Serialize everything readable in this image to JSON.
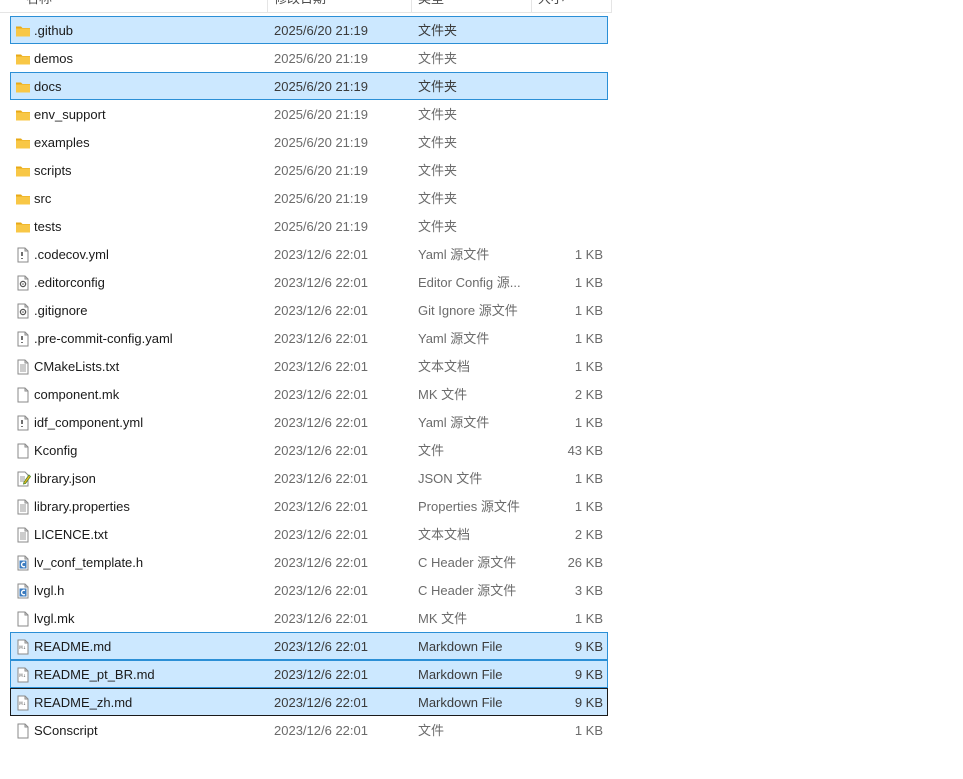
{
  "header": {
    "name": "名称",
    "date": "修改日期",
    "type": "类型",
    "size": "大小"
  },
  "files": [
    {
      "name": ".github",
      "date": "2025/6/20 21:19",
      "type": "文件夹",
      "size": "",
      "icon": "folder-icon",
      "state": "selected"
    },
    {
      "name": "demos",
      "date": "2025/6/20 21:19",
      "type": "文件夹",
      "size": "",
      "icon": "folder-icon",
      "state": ""
    },
    {
      "name": "docs",
      "date": "2025/6/20 21:19",
      "type": "文件夹",
      "size": "",
      "icon": "folder-icon",
      "state": "selected"
    },
    {
      "name": "env_support",
      "date": "2025/6/20 21:19",
      "type": "文件夹",
      "size": "",
      "icon": "folder-icon",
      "state": ""
    },
    {
      "name": "examples",
      "date": "2025/6/20 21:19",
      "type": "文件夹",
      "size": "",
      "icon": "folder-icon",
      "state": ""
    },
    {
      "name": "scripts",
      "date": "2025/6/20 21:19",
      "type": "文件夹",
      "size": "",
      "icon": "folder-icon",
      "state": ""
    },
    {
      "name": "src",
      "date": "2025/6/20 21:19",
      "type": "文件夹",
      "size": "",
      "icon": "folder-icon",
      "state": ""
    },
    {
      "name": "tests",
      "date": "2025/6/20 21:19",
      "type": "文件夹",
      "size": "",
      "icon": "folder-icon",
      "state": ""
    },
    {
      "name": ".codecov.yml",
      "date": "2023/12/6 22:01",
      "type": "Yaml 源文件",
      "size": "1 KB",
      "icon": "yaml-file-icon",
      "state": ""
    },
    {
      "name": ".editorconfig",
      "date": "2023/12/6 22:01",
      "type": "Editor Config 源...",
      "size": "1 KB",
      "icon": "config-file-icon",
      "state": ""
    },
    {
      "name": ".gitignore",
      "date": "2023/12/6 22:01",
      "type": "Git Ignore 源文件",
      "size": "1 KB",
      "icon": "config-file-icon",
      "state": ""
    },
    {
      "name": ".pre-commit-config.yaml",
      "date": "2023/12/6 22:01",
      "type": "Yaml 源文件",
      "size": "1 KB",
      "icon": "yaml-file-icon",
      "state": ""
    },
    {
      "name": "CMakeLists.txt",
      "date": "2023/12/6 22:01",
      "type": "文本文档",
      "size": "1 KB",
      "icon": "text-file-icon",
      "state": ""
    },
    {
      "name": "component.mk",
      "date": "2023/12/6 22:01",
      "type": "MK 文件",
      "size": "2 KB",
      "icon": "blank-file-icon",
      "state": ""
    },
    {
      "name": "idf_component.yml",
      "date": "2023/12/6 22:01",
      "type": "Yaml 源文件",
      "size": "1 KB",
      "icon": "yaml-file-icon",
      "state": ""
    },
    {
      "name": "Kconfig",
      "date": "2023/12/6 22:01",
      "type": "文件",
      "size": "43 KB",
      "icon": "blank-file-icon",
      "state": ""
    },
    {
      "name": "library.json",
      "date": "2023/12/6 22:01",
      "type": "JSON 文件",
      "size": "1 KB",
      "icon": "json-file-icon",
      "state": ""
    },
    {
      "name": "library.properties",
      "date": "2023/12/6 22:01",
      "type": "Properties 源文件",
      "size": "1 KB",
      "icon": "text-file-icon",
      "state": ""
    },
    {
      "name": "LICENCE.txt",
      "date": "2023/12/6 22:01",
      "type": "文本文档",
      "size": "2 KB",
      "icon": "text-file-icon",
      "state": ""
    },
    {
      "name": "lv_conf_template.h",
      "date": "2023/12/6 22:01",
      "type": "C Header 源文件",
      "size": "26 KB",
      "icon": "c-header-file-icon",
      "state": ""
    },
    {
      "name": "lvgl.h",
      "date": "2023/12/6 22:01",
      "type": "C Header 源文件",
      "size": "3 KB",
      "icon": "c-header-file-icon",
      "state": ""
    },
    {
      "name": "lvgl.mk",
      "date": "2023/12/6 22:01",
      "type": "MK 文件",
      "size": "1 KB",
      "icon": "blank-file-icon",
      "state": ""
    },
    {
      "name": "README.md",
      "date": "2023/12/6 22:01",
      "type": "Markdown File",
      "size": "9 KB",
      "icon": "markdown-file-icon",
      "state": "selected"
    },
    {
      "name": "README_pt_BR.md",
      "date": "2023/12/6 22:01",
      "type": "Markdown File",
      "size": "9 KB",
      "icon": "markdown-file-icon",
      "state": "selected"
    },
    {
      "name": "README_zh.md",
      "date": "2023/12/6 22:01",
      "type": "Markdown File",
      "size": "9 KB",
      "icon": "markdown-file-icon",
      "state": "focused"
    },
    {
      "name": "SConscript",
      "date": "2023/12/6 22:01",
      "type": "文件",
      "size": "1 KB",
      "icon": "blank-file-icon",
      "state": ""
    }
  ],
  "colors": {
    "selection_bg": "#cce8ff",
    "selection_border": "#2b8fd6",
    "folder_yellow": "#f8c746"
  }
}
